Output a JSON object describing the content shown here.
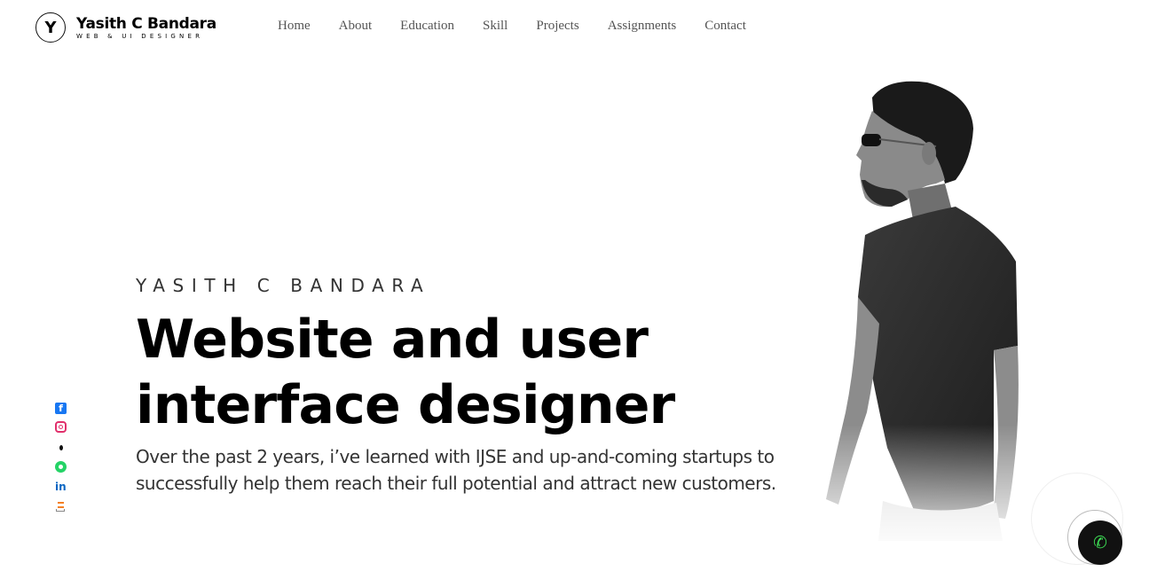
{
  "logo": {
    "mark": "Y",
    "name": "Yasith C Bandara",
    "tagline": "WEB & UI DESIGNER"
  },
  "nav": {
    "items": [
      "Home",
      "About",
      "Education",
      "Skill",
      "Projects",
      "Assignments",
      "Contact"
    ]
  },
  "social": {
    "facebook_glyph": "f",
    "linkedin_glyph": "in"
  },
  "hero": {
    "eyebrow": "YASITH C BANDARA",
    "title": "Website and user interface designer",
    "description": "Over the past 2 years, i’ve learned with IJSE and up-and-coming startups to successfully help them reach their full potential and attract new customers."
  },
  "call_button": {
    "icon": "phone-icon",
    "glyph": "✆"
  },
  "colors": {
    "facebook": "#1877f2",
    "instagram": "#e1306c",
    "whatsapp": "#25d366",
    "linkedin": "#0a66c2",
    "stackoverflow": "#f48024",
    "call_icon": "#3ddc54"
  }
}
